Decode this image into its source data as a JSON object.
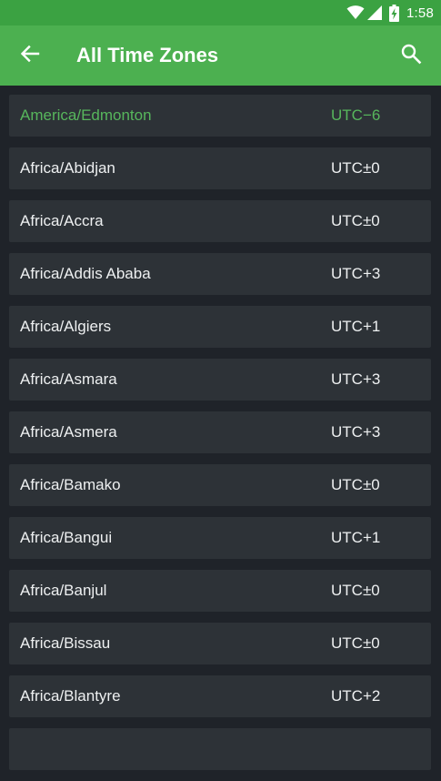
{
  "status_bar": {
    "time": "1:58",
    "icons": [
      "wifi-icon",
      "cell-signal-icon",
      "battery-charging-icon"
    ]
  },
  "app_bar": {
    "title": "All Time Zones",
    "back_icon": "arrow-back-icon",
    "search_icon": "search-icon",
    "color": "#4cb050",
    "status_color": "#3ba242"
  },
  "list": {
    "selected_color": "#57b65c",
    "items": [
      {
        "zone": "America/Edmonton",
        "offset": "UTC−6"
      },
      {
        "zone": "Africa/Abidjan",
        "offset": "UTC±0"
      },
      {
        "zone": "Africa/Accra",
        "offset": "UTC±0"
      },
      {
        "zone": "Africa/Addis Ababa",
        "offset": "UTC+3"
      },
      {
        "zone": "Africa/Algiers",
        "offset": "UTC+1"
      },
      {
        "zone": "Africa/Asmara",
        "offset": "UTC+3"
      },
      {
        "zone": "Africa/Asmera",
        "offset": "UTC+3"
      },
      {
        "zone": "Africa/Bamako",
        "offset": "UTC±0"
      },
      {
        "zone": "Africa/Bangui",
        "offset": "UTC+1"
      },
      {
        "zone": "Africa/Banjul",
        "offset": "UTC±0"
      },
      {
        "zone": "Africa/Bissau",
        "offset": "UTC±0"
      },
      {
        "zone": "Africa/Blantyre",
        "offset": "UTC+2"
      },
      {
        "zone": "",
        "offset": ""
      }
    ]
  }
}
